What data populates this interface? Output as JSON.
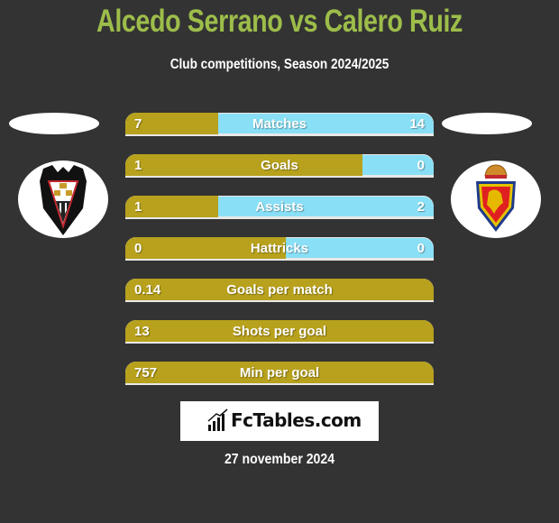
{
  "header": {
    "title": "Alcedo Serrano vs Calero Ruiz",
    "subtitle": "Club competitions, Season 2024/2025"
  },
  "colors": {
    "title": "#9dbd4a",
    "left_bar": "#b8a11c",
    "right_bar": "#89dff5",
    "background": "#333333"
  },
  "teams": {
    "left": {
      "badge_icon": "albacete-crest-icon"
    },
    "right": {
      "badge_icon": "real-zaragoza-crest-icon"
    }
  },
  "stats": [
    {
      "label": "Matches",
      "left": "7",
      "right": "14",
      "left_share": 0.3
    },
    {
      "label": "Goals",
      "left": "1",
      "right": "0",
      "left_share": 0.77
    },
    {
      "label": "Assists",
      "left": "1",
      "right": "2",
      "left_share": 0.3
    },
    {
      "label": "Hattricks",
      "left": "0",
      "right": "0",
      "left_share": 0.52
    },
    {
      "label": "Goals per match",
      "left": "0.14",
      "right": "",
      "left_share": 1.0
    },
    {
      "label": "Shots per goal",
      "left": "13",
      "right": "",
      "left_share": 1.0
    },
    {
      "label": "Min per goal",
      "left": "757",
      "right": "",
      "left_share": 1.0
    }
  ],
  "footer": {
    "brand": "FcTables.com",
    "brand_icon": "bar-chart-icon",
    "date": "27 november 2024"
  }
}
